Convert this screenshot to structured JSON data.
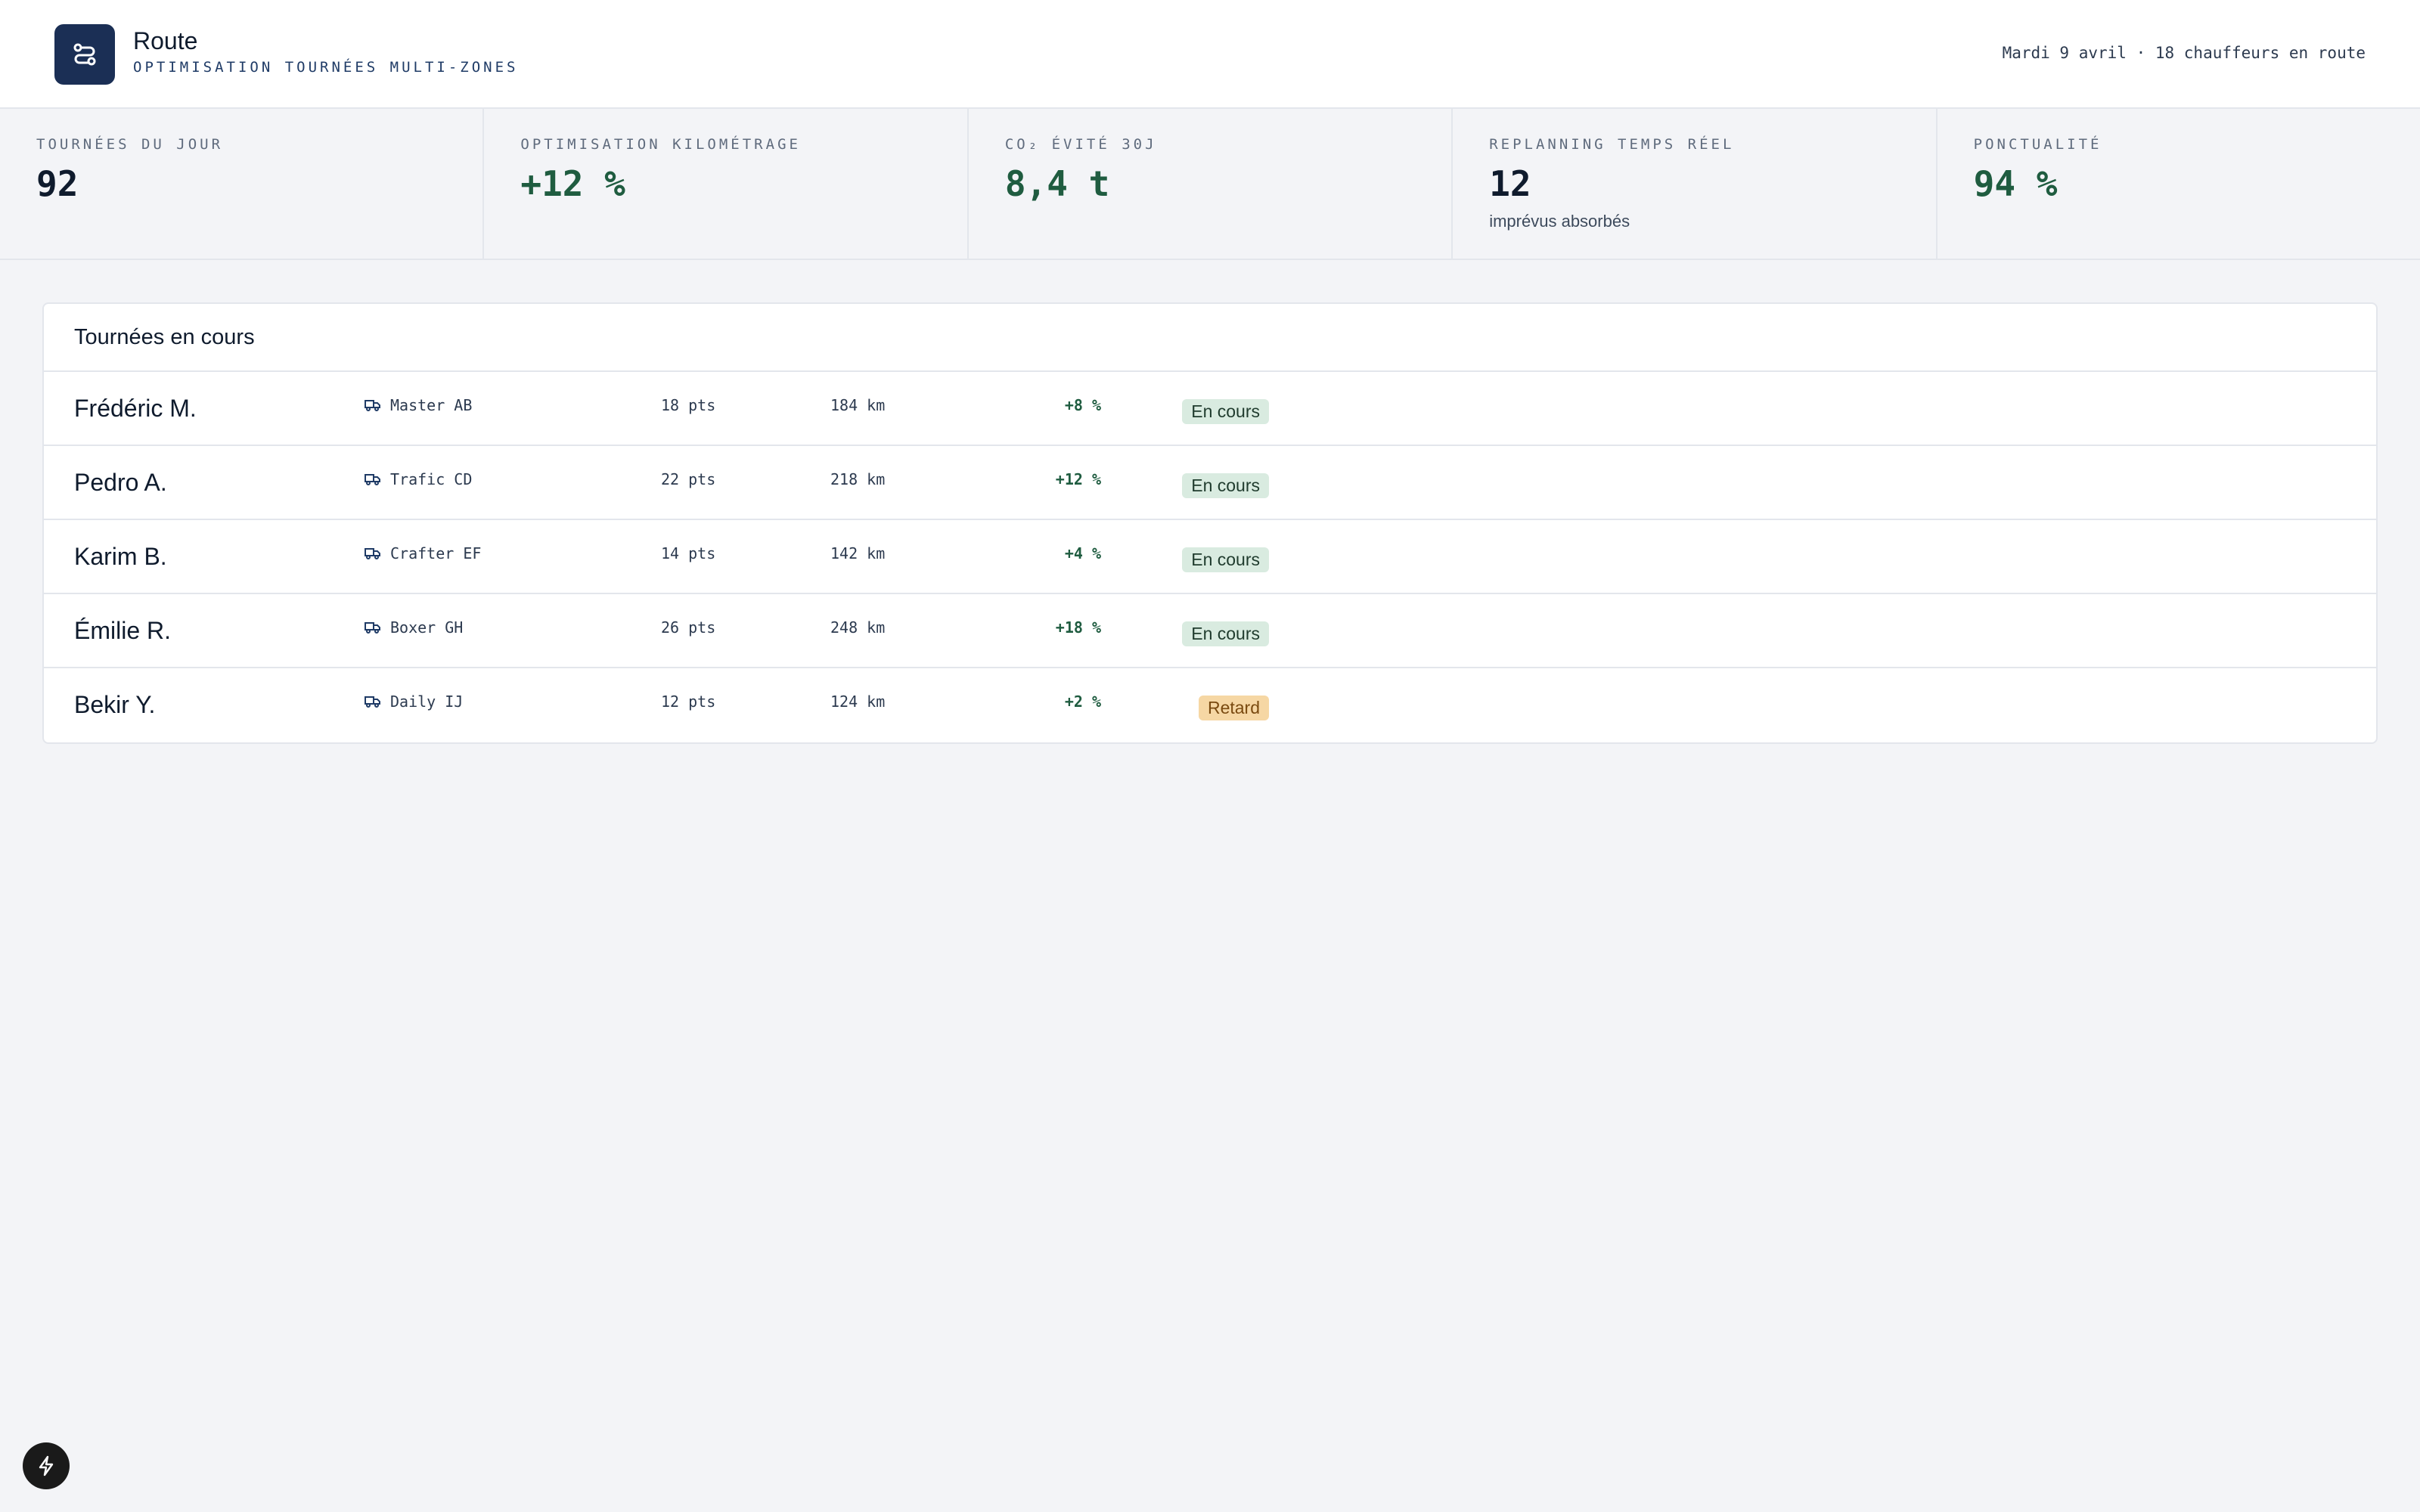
{
  "app": {
    "title": "Route",
    "subtitle": "OPTIMISATION TOURNÉES MULTI-ZONES",
    "header_info": "Mardi 9 avril · 18 chauffeurs en route"
  },
  "kpis": [
    {
      "label": "TOURNÉES DU JOUR",
      "value": "92",
      "note": ""
    },
    {
      "label": "OPTIMISATION KILOMÉTRAGE",
      "value": "+12 %",
      "note": ""
    },
    {
      "label": "CO₂ ÉVITÉ 30J",
      "value": "8,4 t",
      "note": ""
    },
    {
      "label": "REPLANNING TEMPS RÉEL",
      "value": "12",
      "note": "imprévus absorbés"
    },
    {
      "label": "PONCTUALITÉ",
      "value": "94 %",
      "note": ""
    }
  ],
  "tours": {
    "title": "Tournées en cours",
    "rows": [
      {
        "driver": "Frédéric M.",
        "vehicle": "Master AB",
        "points": "18 pts",
        "distance": "184 km",
        "gain": "+8 %",
        "status": "En cours"
      },
      {
        "driver": "Pedro A.",
        "vehicle": "Trafic CD",
        "points": "22 pts",
        "distance": "218 km",
        "gain": "+12 %",
        "status": "En cours"
      },
      {
        "driver": "Karim B.",
        "vehicle": "Crafter EF",
        "points": "14 pts",
        "distance": "142 km",
        "gain": "+4 %",
        "status": "En cours"
      },
      {
        "driver": "Émilie R.",
        "vehicle": "Boxer GH",
        "points": "26 pts",
        "distance": "248 km",
        "gain": "+18 %",
        "status": "En cours"
      },
      {
        "driver": "Bekir Y.",
        "vehicle": "Daily IJ",
        "points": "12 pts",
        "distance": "124 km",
        "gain": "+2 %",
        "status": "Retard"
      }
    ]
  },
  "colors": {
    "brand": "#1b2f55",
    "positive": "#1f5c40",
    "status_ok_bg": "#d9ebe0",
    "status_late_bg": "#f6d7a4"
  },
  "icons": {
    "logo": "route-icon",
    "vehicle": "truck-icon",
    "fab": "lightning-icon"
  }
}
